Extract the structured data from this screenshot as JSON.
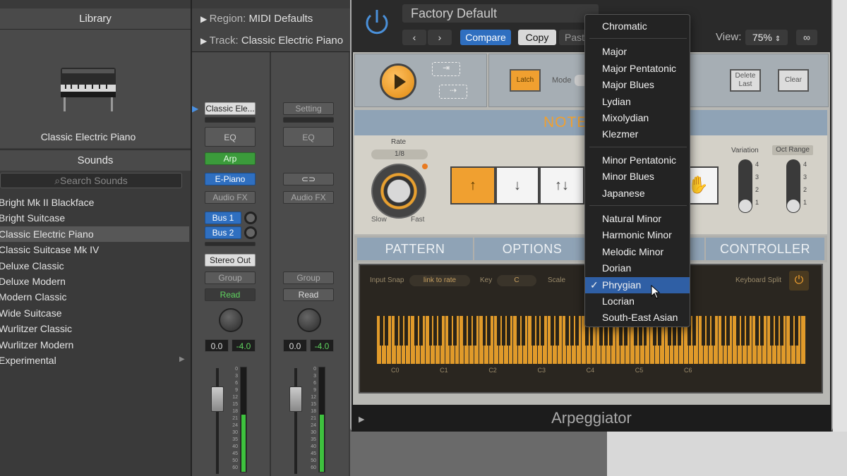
{
  "library": {
    "title": "Library",
    "preview_name": "Classic Electric Piano",
    "sounds_title": "Sounds",
    "search_placeholder": "Search Sounds",
    "items": [
      {
        "label": "Bright Mk II Blackface"
      },
      {
        "label": "Bright Suitcase"
      },
      {
        "label": "Classic Electric Piano"
      },
      {
        "label": "Classic Suitcase Mk IV"
      },
      {
        "label": "Deluxe Classic"
      },
      {
        "label": "Deluxe Modern"
      },
      {
        "label": "Modern Classic"
      },
      {
        "label": "Wide Suitcase"
      },
      {
        "label": "Wurlitzer Classic"
      },
      {
        "label": "Wurlitzer Modern"
      },
      {
        "label": "Experimental"
      }
    ],
    "selected_index": 2
  },
  "inspector": {
    "region_label": "Region:",
    "region_value": "MIDI Defaults",
    "track_label": "Track:",
    "track_value": "Classic Electric Piano"
  },
  "strip1": {
    "setting": "Classic Ele...",
    "eq": "EQ",
    "midi_fx": "Arp",
    "instrument": "E-Piano",
    "audio_fx": "Audio FX",
    "send1": "Bus 1",
    "send2": "Bus 2",
    "output": "Stereo Out",
    "group": "Group",
    "automation": "Read",
    "pan_value": "0.0",
    "volume_value": "-4.0",
    "meter_level": 0.55
  },
  "strip2": {
    "setting": "Setting",
    "eq": "EQ",
    "audio_fx": "Audio FX",
    "group": "Group",
    "automation": "Read",
    "pan_value": "0.0",
    "volume_value": "-4.0",
    "meter_level": 0.55
  },
  "fader_scale": [
    "0",
    "3",
    "6",
    "9",
    "12",
    "15",
    "18",
    "21",
    "24",
    "30",
    "35",
    "40",
    "45",
    "50",
    "60"
  ],
  "plugin": {
    "preset_name": "Factory Default",
    "prev_symbol": "‹",
    "next_symbol": "›",
    "compare_label": "Compare",
    "copy_label": "Copy",
    "paste_label": "Paste",
    "view_label": "View:",
    "view_value": "75%",
    "title": "Arpeggiator"
  },
  "arp": {
    "latch_label": "Latch",
    "mode_label": "Mode",
    "delete_last_label": "Delete Last",
    "clear_label": "Clear",
    "notes_label": "NOTE",
    "rate_label": "Rate",
    "rate_value": "1/8",
    "slow_label": "Slow",
    "fast_label": "Fast",
    "variation_label": "Variation",
    "oct_range_label": "Oct Range",
    "slider_marks": [
      "4",
      "3",
      "2",
      "1"
    ],
    "tabs": [
      "PATTERN",
      "OPTIONS",
      "",
      "CONTROLLER"
    ],
    "input_snap_label": "Input Snap",
    "input_snap_value": "link to rate",
    "key_label": "Key",
    "key_value": "C",
    "scale_label": "Scale",
    "keyboard_split_label": "Keyboard Split",
    "octave_labels": [
      "C0",
      "C1",
      "C2",
      "C3",
      "C4",
      "C5",
      "C6"
    ]
  },
  "scale_menu": {
    "groups": [
      [
        "Chromatic"
      ],
      [
        "Major",
        "Major Pentatonic",
        "Major Blues",
        "Lydian",
        "Mixolydian",
        "Klezmer"
      ],
      [
        "Minor Pentatonic",
        "Minor Blues",
        "Japanese"
      ],
      [
        "Natural Minor",
        "Harmonic Minor",
        "Melodic Minor",
        "Dorian",
        "Phrygian",
        "Locrian",
        "South-East Asian"
      ]
    ],
    "selected": "Phrygian",
    "check_mark": "✓"
  },
  "colors": {
    "accent_blue": "#2f6fc0",
    "arp_orange": "#f0a030",
    "menu_highlight": "#2f5fa5"
  }
}
